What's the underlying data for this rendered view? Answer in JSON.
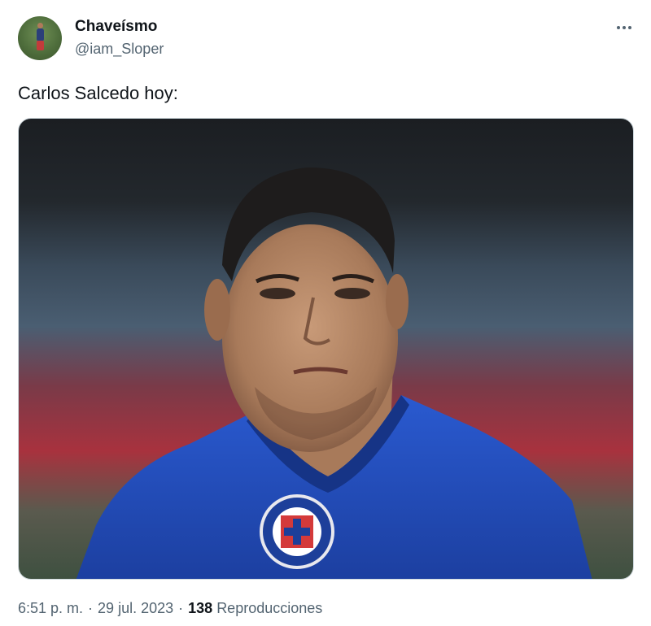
{
  "author": {
    "name": "Chaveísmo",
    "handle": "@iam_Sloper"
  },
  "tweet": {
    "text": "Carlos Salcedo hoy:",
    "time": "6:51 p. m.",
    "date": "29 jul. 2023",
    "separator": "·",
    "views_count": "138",
    "views_label": "Reproducciones"
  },
  "icons": {
    "more": "more-horizontal-icon"
  }
}
